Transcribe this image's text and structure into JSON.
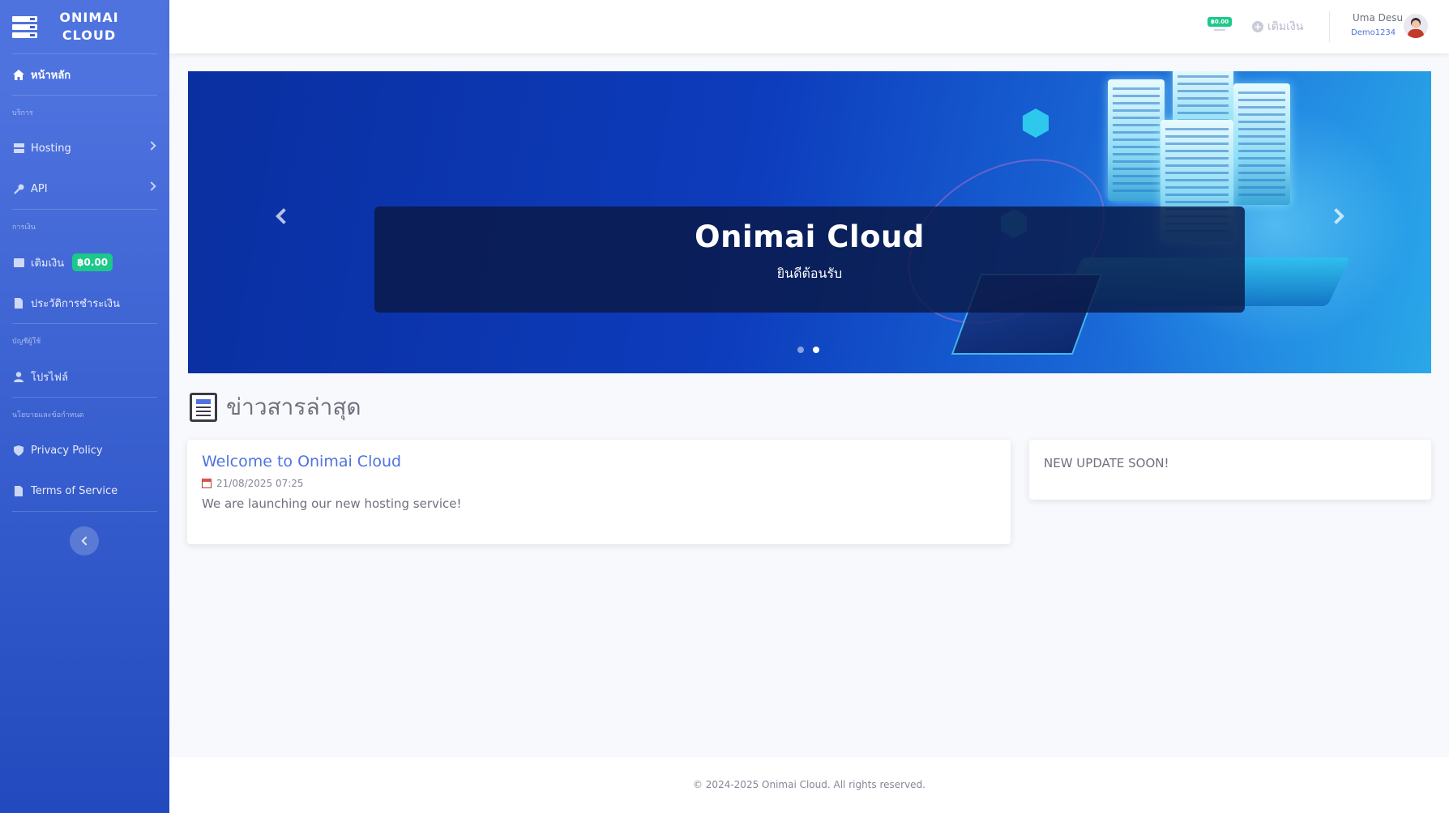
{
  "brand": {
    "line1": "ONIMAI",
    "line2": "CLOUD",
    "icon": "server-icon"
  },
  "sidebar": {
    "home": {
      "label": "หน้าหลัก",
      "icon": "home-icon"
    },
    "sections": {
      "services": "บริการ",
      "finance": "การเงิน",
      "account": "บัญชีผู้ใช้",
      "policy": "นโยบายและข้อกำหนด"
    },
    "hosting": {
      "label": "Hosting",
      "icon": "server-icon"
    },
    "api": {
      "label": "API",
      "icon": "key-icon"
    },
    "topup": {
      "label": "เติมเงิน",
      "balance": "฿0.00",
      "icon": "wallet-icon"
    },
    "history": {
      "label": "ประวัติการชำระเงิน",
      "icon": "file-icon"
    },
    "profile": {
      "label": "โปรไฟล์",
      "icon": "user-icon"
    },
    "privacy": {
      "label": "Privacy Policy",
      "icon": "shield-icon"
    },
    "terms": {
      "label": "Terms of Service",
      "icon": "file-icon"
    }
  },
  "topbar": {
    "balance": "฿0.00",
    "topup_label": "เติมเงิน",
    "user_name": "Uma Desu",
    "user_id": "Demo1234"
  },
  "carousel": {
    "title": "Onimai Cloud",
    "subtitle": "ยินดีต้อนรับ",
    "slides": 2,
    "active_slide": 2
  },
  "news": {
    "heading": "ข่าวสารล่าสุด",
    "main": {
      "title": "Welcome to Onimai Cloud",
      "date": "21/08/2025 07:25",
      "body": "We are launching our new hosting service!"
    },
    "side": {
      "text": "NEW UPDATE SOON!"
    }
  },
  "footer": {
    "text": "© 2024-2025 Onimai Cloud. All rights reserved."
  },
  "colors": {
    "primary": "#4e73df",
    "success": "#1cc88a",
    "sidebar_bottom": "#224abe"
  }
}
